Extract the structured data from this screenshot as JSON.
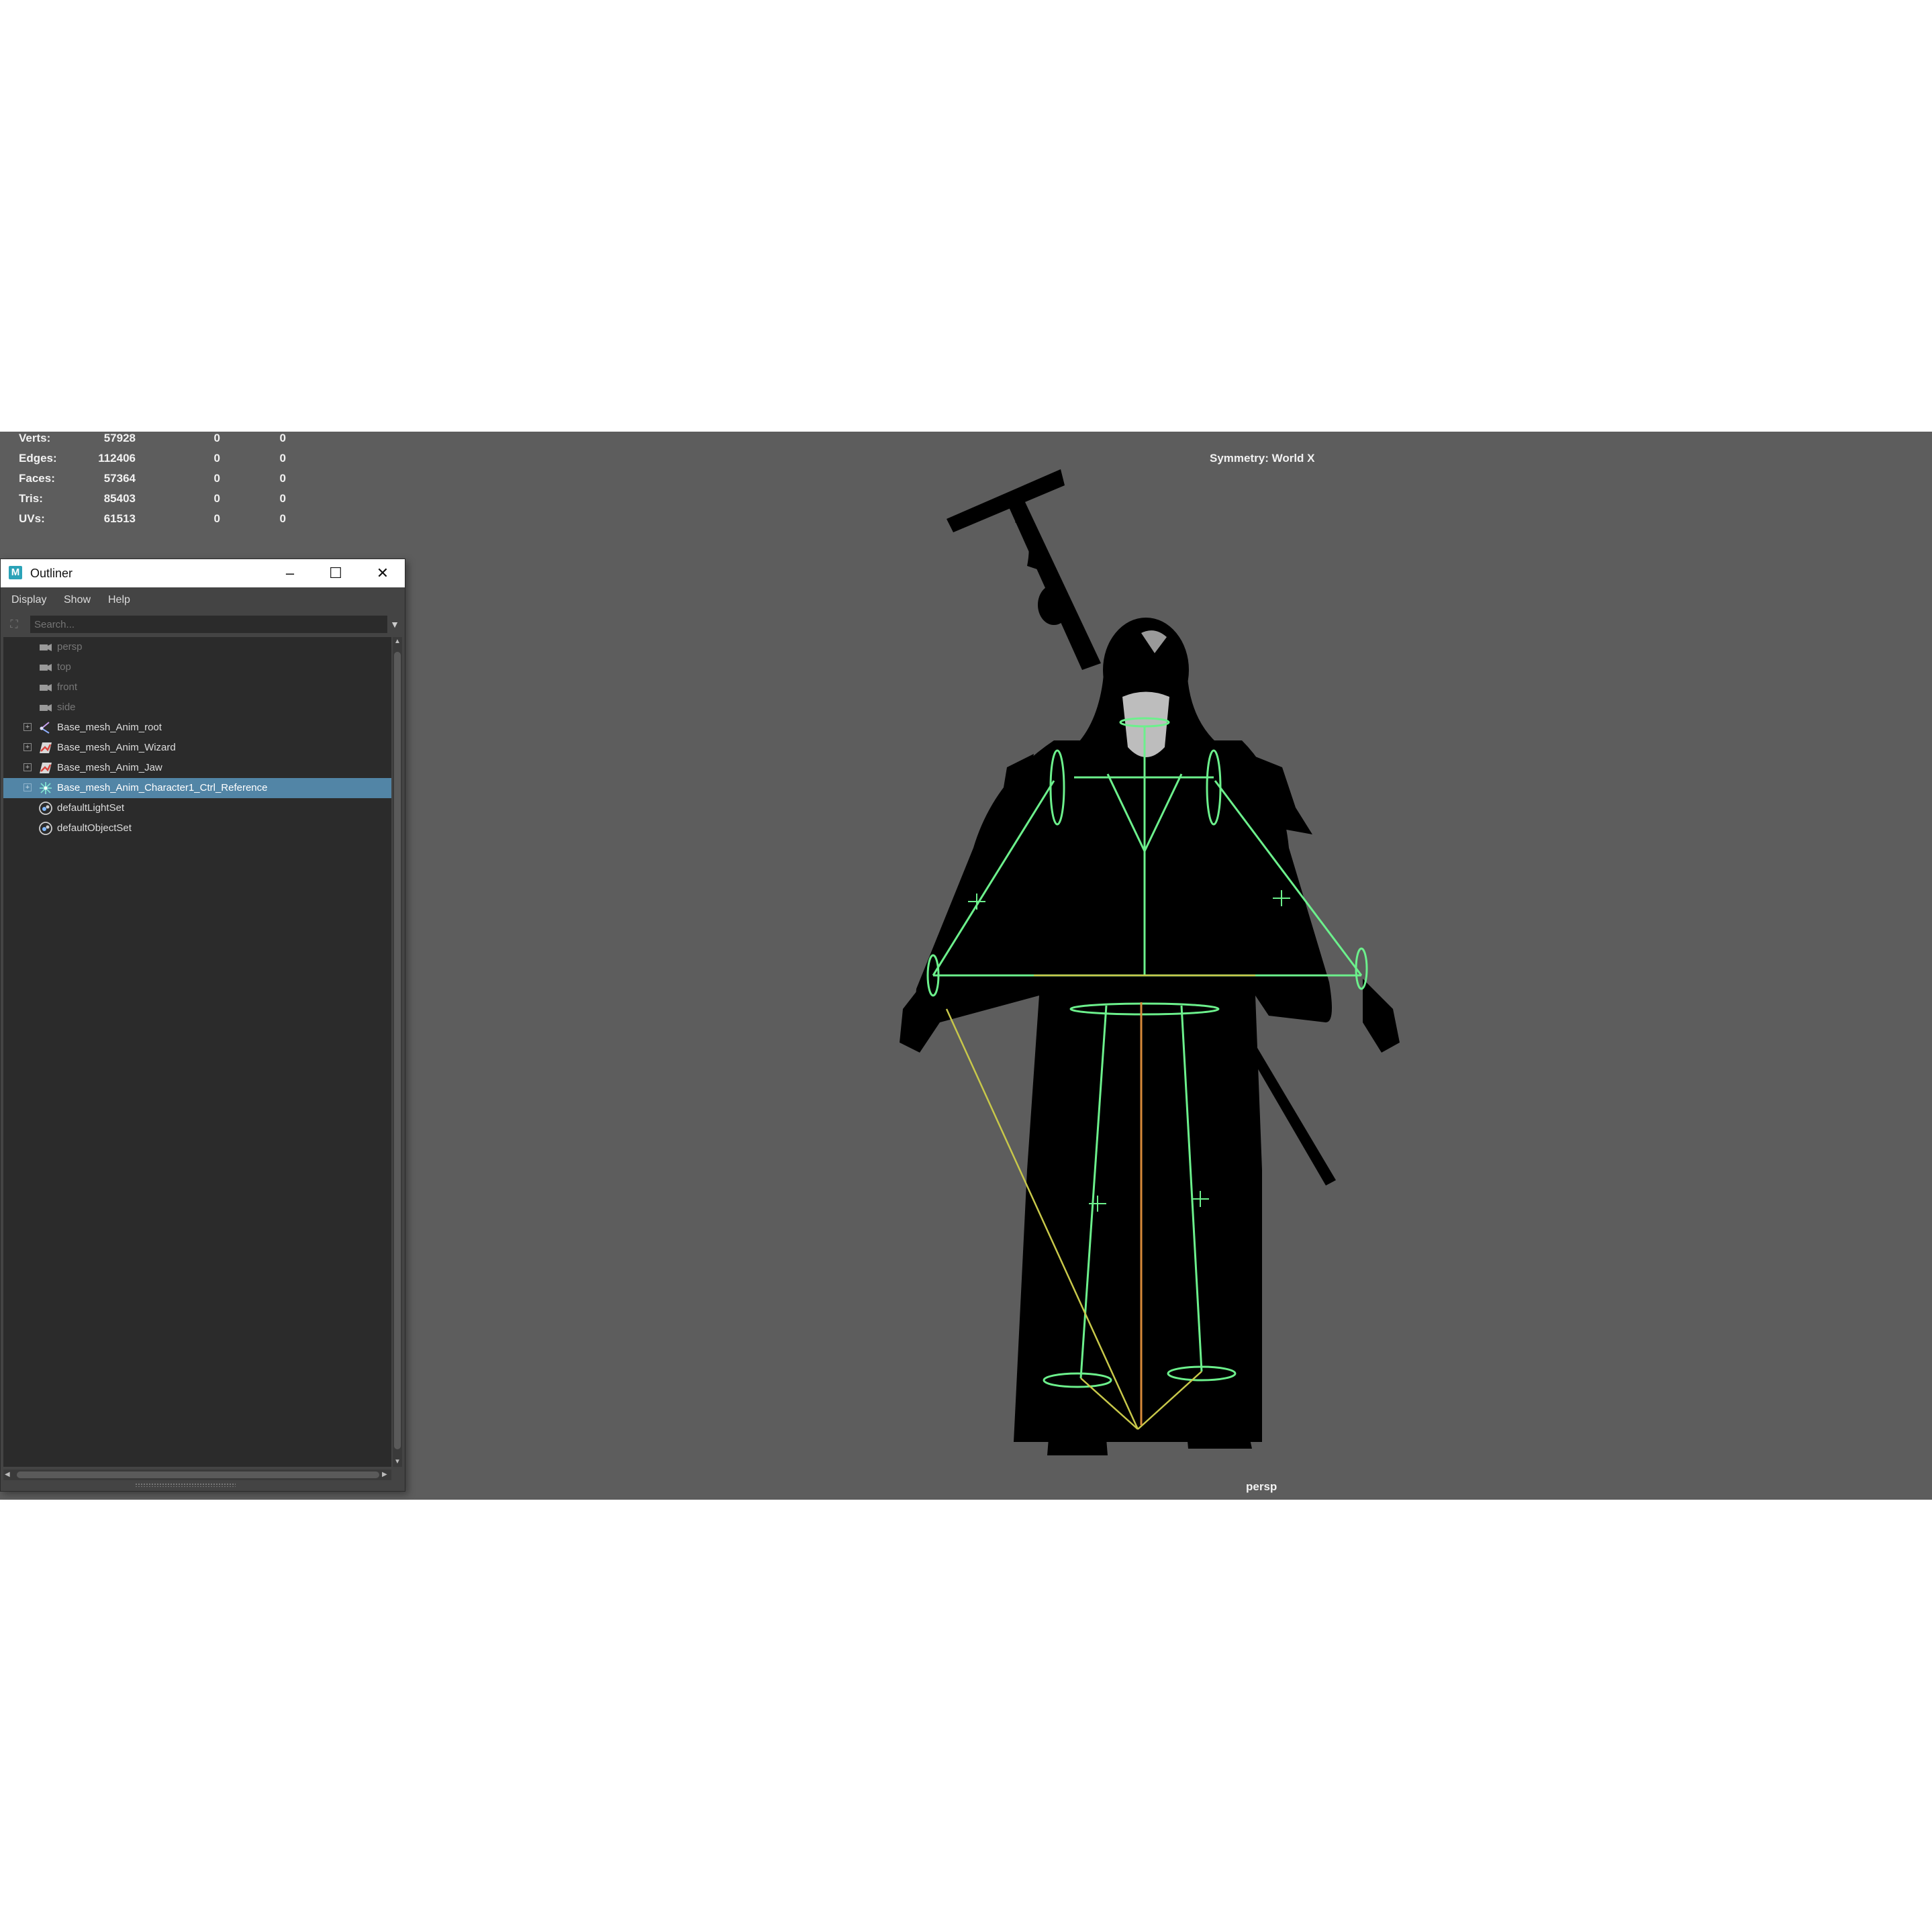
{
  "hud": {
    "rows": [
      {
        "label": "Verts:",
        "v1": "57928",
        "v2": "0",
        "v3": "0"
      },
      {
        "label": "Edges:",
        "v1": "112406",
        "v2": "0",
        "v3": "0"
      },
      {
        "label": "Faces:",
        "v1": "57364",
        "v2": "0",
        "v3": "0"
      },
      {
        "label": "Tris:",
        "v1": "85403",
        "v2": "0",
        "v3": "0"
      },
      {
        "label": "UVs:",
        "v1": "61513",
        "v2": "0",
        "v3": "0"
      }
    ]
  },
  "viewport": {
    "symmetry": "Symmetry: World X",
    "camera": "persp",
    "background": "#5d5d5d",
    "rig_color": "#6cf08c"
  },
  "outliner": {
    "title": "Outliner",
    "logo": "M",
    "minimize": "–",
    "maximize": "☐",
    "close": "✕",
    "menus": [
      "Display",
      "Show",
      "Help"
    ],
    "search_placeholder": "Search...",
    "items": [
      {
        "label": "persp",
        "icon": "camera-icon",
        "dim": true
      },
      {
        "label": "top",
        "icon": "camera-icon",
        "dim": true
      },
      {
        "label": "front",
        "icon": "camera-icon",
        "dim": true
      },
      {
        "label": "side",
        "icon": "camera-icon",
        "dim": true
      },
      {
        "label": "Base_mesh_Anim_root",
        "icon": "joint-icon"
      },
      {
        "label": "Base_mesh_Anim_Wizard",
        "icon": "mesh-icon"
      },
      {
        "label": "Base_mesh_Anim_Jaw",
        "icon": "mesh-icon"
      },
      {
        "label": "Base_mesh_Anim_Character1_Ctrl_Reference",
        "icon": "hik-reference-icon",
        "selected": true
      },
      {
        "label": "defaultLightSet",
        "icon": "set-icon"
      },
      {
        "label": "defaultObjectSet",
        "icon": "set-icon"
      }
    ],
    "selection_color": "#5285a6"
  }
}
